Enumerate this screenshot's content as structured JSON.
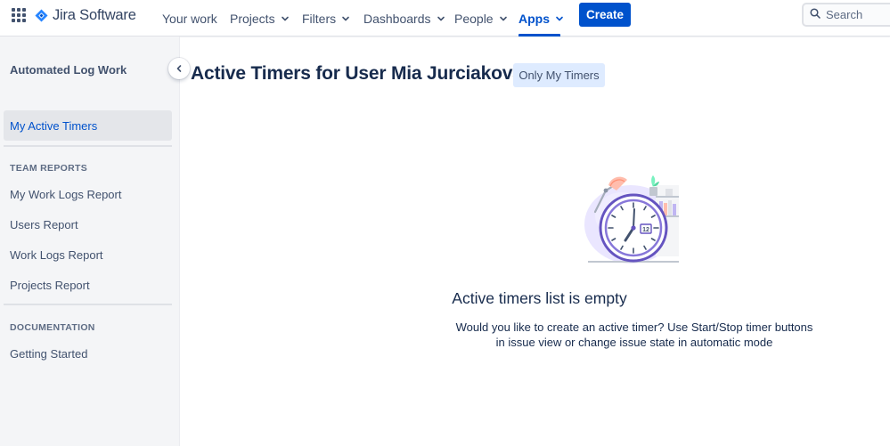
{
  "nav": {
    "logo_text": "Jira Software",
    "items": [
      {
        "label": "Your work"
      },
      {
        "label": "Projects"
      },
      {
        "label": "Filters"
      },
      {
        "label": "Dashboards"
      },
      {
        "label": "People"
      },
      {
        "label": "Apps"
      }
    ],
    "active_item": "Apps",
    "create_label": "Create",
    "search_placeholder": "Search"
  },
  "sidebar": {
    "title": "Automated Log Work",
    "selected_item": "My Active Timers",
    "sections": [
      {
        "heading": "",
        "items": [
          {
            "label": "My Active Timers"
          }
        ]
      },
      {
        "heading": "TEAM REPORTS",
        "items": [
          {
            "label": "My Work Logs Report"
          },
          {
            "label": "Users Report"
          },
          {
            "label": "Work Logs Report"
          },
          {
            "label": "Projects Report"
          }
        ]
      },
      {
        "heading": "DOCUMENTATION",
        "items": [
          {
            "label": "Getting Started"
          }
        ]
      }
    ]
  },
  "main": {
    "title": "Active Timers for User Mia Jurciakova",
    "filter_button": "Only My Timers",
    "empty_state": {
      "title": "Active timers list is empty",
      "line1": "Would you like to create an active timer? Use Start/Stop timer buttons",
      "line2": "in issue view or change issue state in automatic mode",
      "clock_badge": "12"
    }
  },
  "colors": {
    "brand_blue": "#0052cc",
    "sidebar_bg": "#f4f5f7",
    "selected_bg": "#e4e6ea",
    "filter_button_bg": "#deebff",
    "text_primary": "#172b4d",
    "text_secondary": "#42526e"
  },
  "icons": {
    "app_switcher": "grid-icon",
    "logo": "jira-diamond-icon",
    "chevron": "chevron-down-icon",
    "search": "search-icon",
    "collapse": "chevron-left-icon",
    "illustration": "clock-illustration"
  }
}
